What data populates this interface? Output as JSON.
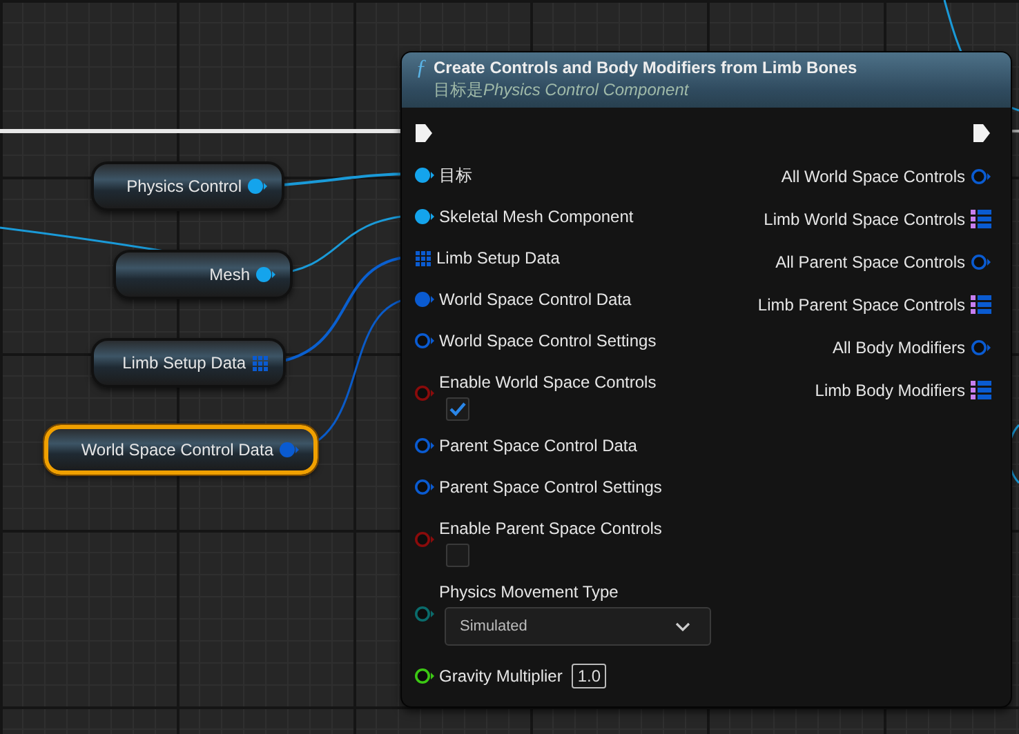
{
  "variable_nodes": [
    {
      "label": "Physics Control",
      "pin": {
        "kind": "object"
      },
      "selected": false
    },
    {
      "label": "Mesh",
      "pin": {
        "kind": "object"
      },
      "selected": false
    },
    {
      "label": "Limb Setup Data",
      "pin": {
        "kind": "grid"
      },
      "selected": false
    },
    {
      "label": "World Space Control Data",
      "pin": {
        "kind": "struct"
      },
      "selected": true
    }
  ],
  "function_node": {
    "icon": "ƒ",
    "title": "Create Controls and Body Modifiers from Limb Bones",
    "subtitle_prefix": "目标是",
    "subtitle_target": "Physics Control Component",
    "inputs": [
      {
        "kind": "pin",
        "label": "目标",
        "pin": {
          "kind": "object",
          "connected": true
        }
      },
      {
        "kind": "pin",
        "label": "Skeletal Mesh Component",
        "pin": {
          "kind": "object",
          "connected": true
        }
      },
      {
        "kind": "pin",
        "label": "Limb Setup Data",
        "pin": {
          "kind": "grid"
        }
      },
      {
        "kind": "pin",
        "label": "World Space Control Data",
        "pin": {
          "kind": "struct",
          "connected": true
        }
      },
      {
        "kind": "pin",
        "label": "World Space Control Settings",
        "pin": {
          "kind": "struct",
          "connected": false
        }
      },
      {
        "kind": "checkbox",
        "label": "Enable World Space Controls",
        "pin": {
          "kind": "bool",
          "connected": false
        },
        "checked": true
      },
      {
        "kind": "pin",
        "label": "Parent Space Control Data",
        "pin": {
          "kind": "struct",
          "connected": false
        }
      },
      {
        "kind": "pin",
        "label": "Parent Space Control Settings",
        "pin": {
          "kind": "struct",
          "connected": false
        }
      },
      {
        "kind": "checkbox",
        "label": "Enable Parent Space Controls",
        "pin": {
          "kind": "bool",
          "connected": false
        },
        "checked": false
      },
      {
        "kind": "dropdown",
        "label": "Physics Movement Type",
        "pin": {
          "kind": "enum",
          "connected": false
        },
        "value": "Simulated"
      },
      {
        "kind": "number",
        "label": "Gravity Multiplier",
        "pin": {
          "kind": "float",
          "connected": false
        },
        "value": "1.0"
      }
    ],
    "outputs": [
      {
        "label": "All World Space Controls",
        "pin": {
          "kind": "struct",
          "connected": false
        }
      },
      {
        "label": "Limb World Space Controls",
        "pin": {
          "kind": "list"
        }
      },
      {
        "label": "All Parent Space Controls",
        "pin": {
          "kind": "struct",
          "connected": false
        }
      },
      {
        "label": "Limb Parent Space Controls",
        "pin": {
          "kind": "list"
        }
      },
      {
        "label": "All Body Modifiers",
        "pin": {
          "kind": "struct",
          "connected": false
        }
      },
      {
        "label": "Limb Body Modifiers",
        "pin": {
          "kind": "list"
        }
      }
    ]
  }
}
